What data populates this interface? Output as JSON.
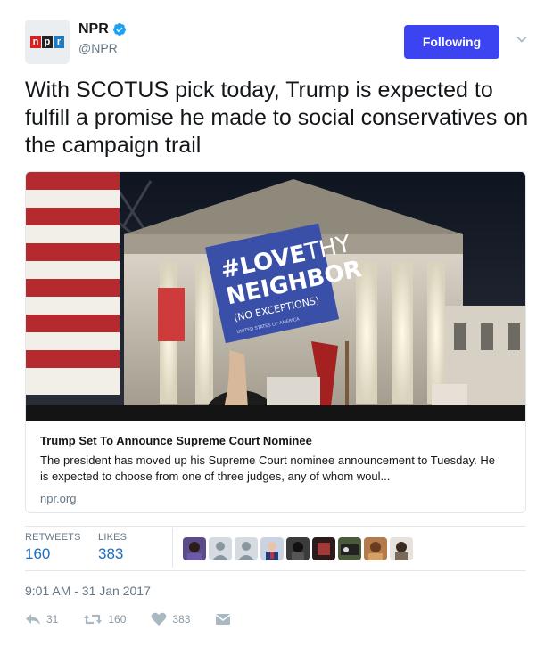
{
  "account": {
    "display_name": "NPR",
    "handle": "@NPR",
    "logo_letters": [
      "n",
      "p",
      "r"
    ]
  },
  "follow_button": {
    "label": "Following"
  },
  "tweet": {
    "text": "With SCOTUS pick today, Trump is expected to fulfill a promise he made to social conservatives on the campaign trail"
  },
  "card": {
    "image_sign": {
      "line1_a": "#LOVE",
      "line1_b": "THY",
      "line2": "NEIGHBOR",
      "line3": "(NO EXCEPTIONS)",
      "fine_print": "UNITED STATES OF AMERICA"
    },
    "title": "Trump Set To Announce Supreme Court Nominee",
    "description": "The president has moved up his Supreme Court nominee announcement to Tuesday. He is expected to choose from one of three judges, any of whom woul...",
    "domain": "npr.org"
  },
  "stats": {
    "retweets_label": "RETWEETS",
    "retweets_value": "160",
    "likes_label": "LIKES",
    "likes_value": "383",
    "liker_count": 9
  },
  "timestamp": "9:01 AM - 31 Jan 2017",
  "actions": {
    "reply_count": "31",
    "retweet_count": "160",
    "like_count": "383"
  },
  "colors": {
    "follow_button": "#3b44f0",
    "link_blue": "#1b6ec2",
    "muted": "#657786",
    "verified": "#1da1f2"
  }
}
